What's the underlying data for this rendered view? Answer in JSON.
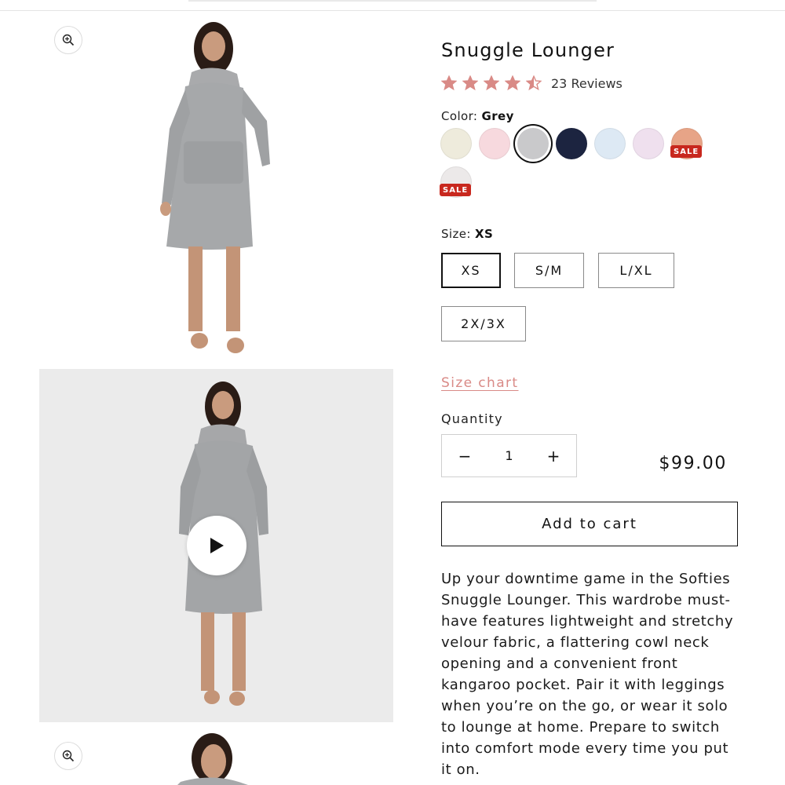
{
  "product": {
    "title": "Snuggle Lounger",
    "rating": 4.5,
    "reviews_label": "23 Reviews",
    "star_color": "#d98a86"
  },
  "color": {
    "label": "Color:",
    "selected": "Grey",
    "swatches": [
      {
        "name": "Cream",
        "color": "#eeebdc",
        "sale": false
      },
      {
        "name": "Pink",
        "color": "#f7d9de",
        "sale": false
      },
      {
        "name": "Grey",
        "color": "#c9c9cb",
        "sale": false,
        "selected": true
      },
      {
        "name": "Navy",
        "color": "#1c2440",
        "sale": false
      },
      {
        "name": "Light Blue",
        "color": "#dde9f4",
        "sale": false
      },
      {
        "name": "Lilac",
        "color": "#efe0ee",
        "sale": false
      },
      {
        "name": "Peach",
        "color": "#e7a487",
        "sale": true
      },
      {
        "name": "Off White",
        "color": "#ece9e9",
        "sale": true
      }
    ],
    "sale_badge": "SALE"
  },
  "size": {
    "label": "Size:",
    "selected": "XS",
    "options": [
      "XS",
      "S/M",
      "L/XL",
      "2X/3X"
    ]
  },
  "size_chart_link": "Size chart",
  "quantity": {
    "label": "Quantity",
    "value": "1",
    "decrease": "−",
    "increase": "+"
  },
  "price": "$99.00",
  "add_to_cart": "Add to cart",
  "description": "Up your downtime game in the Softies Snuggle Lounger. This wardrobe must-have features lightweight and stretchy velour fabric, a flattering cowl neck opening and a convenient front kangaroo pocket. Pair it with leggings when you’re on the go, or wear it solo to lounge at home. Prepare to switch into comfort mode every time you put it on."
}
